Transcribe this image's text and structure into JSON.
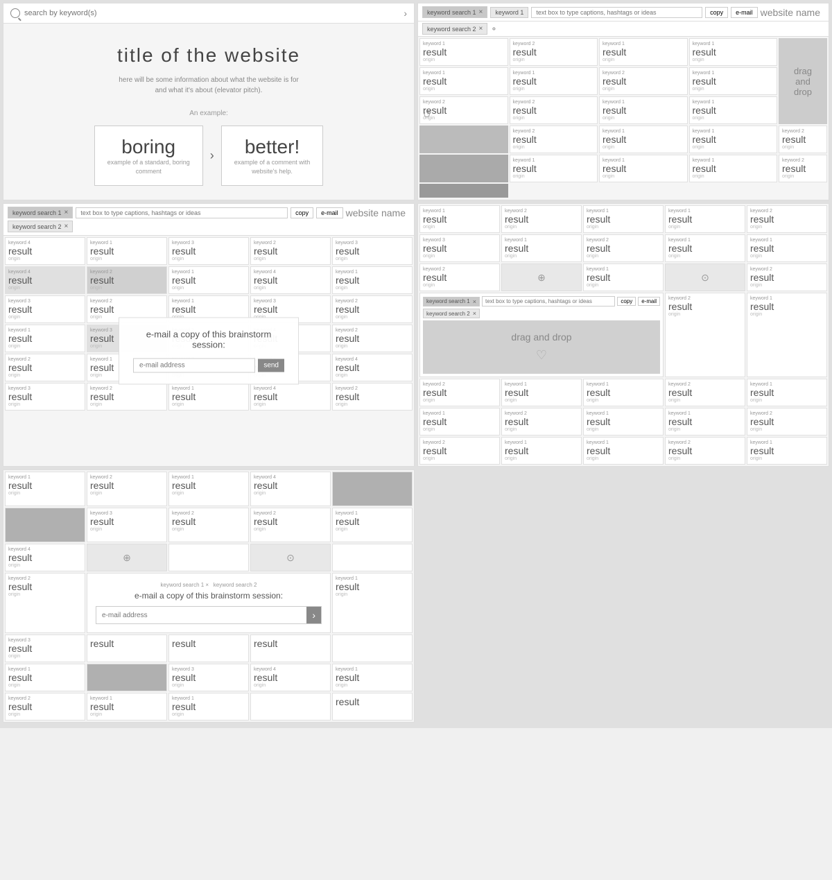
{
  "panel1": {
    "search_placeholder": "search by keyword(s)",
    "hero_title": "title of the website",
    "hero_desc": "here will be some information about what the website is for\nand what it's about (elevator pitch).",
    "example_label": "An example:",
    "boring_word": "boring",
    "boring_sub": "example of a standard, boring\ncomment",
    "better_word": "better!",
    "better_sub": "example of a comment with\nwebsite's help."
  },
  "panel2": {
    "keyword_search_1": "keyword search 1",
    "keyword_search_2": "keyword search 2",
    "keyword_tag_active": "keyword 1",
    "text_input_placeholder": "text box to type captions, hashtags or ideas",
    "copy_label": "copy",
    "email_label": "e-mail",
    "drag_drop": "drag\nand\ndrop",
    "site_name": "website name",
    "cards": [
      {
        "kw": "keyword 1",
        "result": "result",
        "origin": "origin"
      },
      {
        "kw": "keyword 2",
        "result": "result",
        "origin": "origin"
      },
      {
        "kw": "keyword 1",
        "result": "result",
        "origin": "origin"
      },
      {
        "kw": "keyword 1",
        "result": "result",
        "origin": "origin"
      },
      {
        "kw": "keyword 1",
        "result": "result",
        "origin": "origin"
      },
      {
        "kw": "keyword 1",
        "result": "result",
        "origin": "origin"
      },
      {
        "kw": "keyword 2",
        "result": "result",
        "origin": "origin"
      },
      {
        "kw": "keyword 1",
        "result": "result",
        "origin": "origin"
      },
      {
        "kw": "keyword 1",
        "result": "result",
        "origin": "origin"
      },
      {
        "kw": "keyword 1",
        "result": "result",
        "origin": "origin"
      },
      {
        "kw": "keyword 2",
        "result": "result",
        "origin": "origin"
      },
      {
        "kw": "keyword 2",
        "result": "result",
        "origin": "origin"
      },
      {
        "kw": "keyword 1",
        "result": "result",
        "origin": "origin"
      },
      {
        "kw": "keyword 2",
        "result": "result",
        "origin": "origin"
      },
      {
        "kw": "keyword 1",
        "result": "result",
        "origin": "origin"
      },
      {
        "kw": "keyword 2",
        "result": "result",
        "origin": "origin"
      },
      {
        "kw": "keyword 1",
        "result": "result",
        "origin": "origin"
      },
      {
        "kw": "keyword 1",
        "result": "result",
        "origin": "origin"
      },
      {
        "kw": "keyword 2",
        "result": "result",
        "origin": "origin"
      },
      {
        "kw": "keyword 1",
        "result": "result",
        "origin": "origin"
      }
    ]
  },
  "panel3": {
    "keyword_search_1": "keyword search 1",
    "keyword_search_2": "keyword search 2",
    "text_input_placeholder": "text box to type captions, hashtags or ideas",
    "copy_label": "copy",
    "email_label": "e-mail",
    "drag_drop": "drag\nand\ndrop",
    "rotate_icon": "↺",
    "site_name": "website name"
  },
  "panel4": {
    "keyword_search_1": "keyword search 1",
    "keyword_search_2": "keyword search 2",
    "text_input_placeholder": "text box to type captions, hashtags or ideas",
    "copy_label": "copy",
    "email_label": "e-mail",
    "overlay_title": "e-mail a copy of this brainstorm session:",
    "email_placeholder": "e-mail address",
    "send_label": "send",
    "site_name": "website name"
  },
  "panel5": {
    "keyword_search_1": "keyword search 1",
    "keyword_search_2": "keyword search 2",
    "text_input_placeholder": "text box to type captions, hashtags or ideas",
    "copy_label": "copy",
    "email_label": "e-mail",
    "drag_drop": "drag and drop",
    "heart": "♡"
  },
  "panel6": {
    "overlay_title": "e-mail a copy of this brainstorm session:",
    "email_placeholder": "e-mail address",
    "send_arrow": "›"
  },
  "common": {
    "result": "result",
    "origin": "origin",
    "keyword_1": "keyword 1",
    "keyword_2": "keyword 2",
    "keyword_3": "keyword 3",
    "keyword_4": "keyword 4"
  }
}
